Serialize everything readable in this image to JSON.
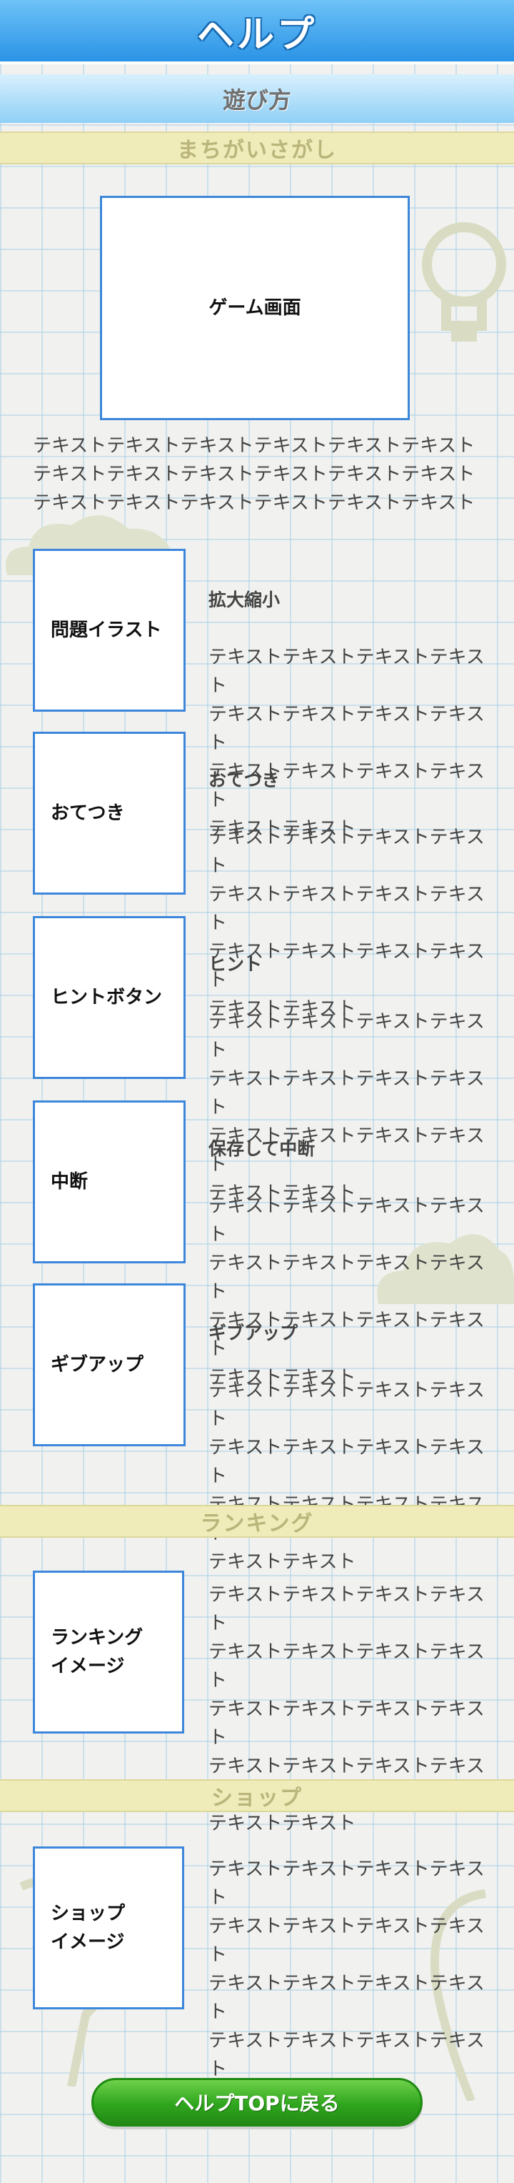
{
  "header": {
    "title": "ヘルプ"
  },
  "subheader": {
    "title": "遊び方"
  },
  "sections": {
    "spot": {
      "title": "まちがいさがし"
    },
    "ranking": {
      "title": "ランキング"
    },
    "shop": {
      "title": "ショップ"
    }
  },
  "game_screen": {
    "label": "ゲーム画面"
  },
  "intro_text": "テキストテキストテキストテキストテキストテキスト\nテキストテキストテキストテキストテキストテキスト\nテキストテキストテキストテキストテキストテキスト",
  "items": [
    {
      "box_label": "問題イラスト",
      "title": "拡大縮小",
      "text": "テキストテキストテキストテキスト\nテキストテキストテキストテキスト\nテキストテキストテキストテキスト\nテキストテキスト"
    },
    {
      "box_label": "おてつき",
      "title": "おてつき",
      "text": "テキストテキストテキストテキスト\nテキストテキストテキストテキスト\nテキストテキストテキストテキスト\nテキストテキスト"
    },
    {
      "box_label": "ヒントボタン",
      "title": "ヒント",
      "text": "テキストテキストテキストテキスト\nテキストテキストテキストテキスト\nテキストテキストテキストテキスト\nテキストテキスト"
    },
    {
      "box_label": "中断",
      "title": "保存して中断",
      "text": "テキストテキストテキストテキスト\nテキストテキストテキストテキスト\nテキストテキストテキストテキスト\nテキストテキスト"
    },
    {
      "box_label": "ギブアップ",
      "title": "ギブアップ",
      "text": "テキストテキストテキストテキスト\nテキストテキストテキストテキスト\nテキストテキストテキストテキスト\nテキストテキスト"
    }
  ],
  "ranking": {
    "box_label": "ランキング\nイメージ",
    "text": "テキストテキストテキストテキスト\nテキストテキストテキストテキスト\nテキストテキストテキストテキスト\nテキストテキストテキストテキスト\nテキストテキスト"
  },
  "shop": {
    "box_label": "ショップ\nイメージ",
    "text": "テキストテキストテキストテキスト\nテキストテキストテキストテキスト\nテキストテキストテキストテキスト\nテキストテキストテキストテキスト\nテキストテキスト"
  },
  "back_button": {
    "label": "ヘルプTOPに戻る"
  },
  "colors": {
    "header": "#2a93e6",
    "subheader": "#8fd0f6",
    "section_bar": "#efecba",
    "box_border": "#3c86db",
    "button": "#2fa51e"
  }
}
